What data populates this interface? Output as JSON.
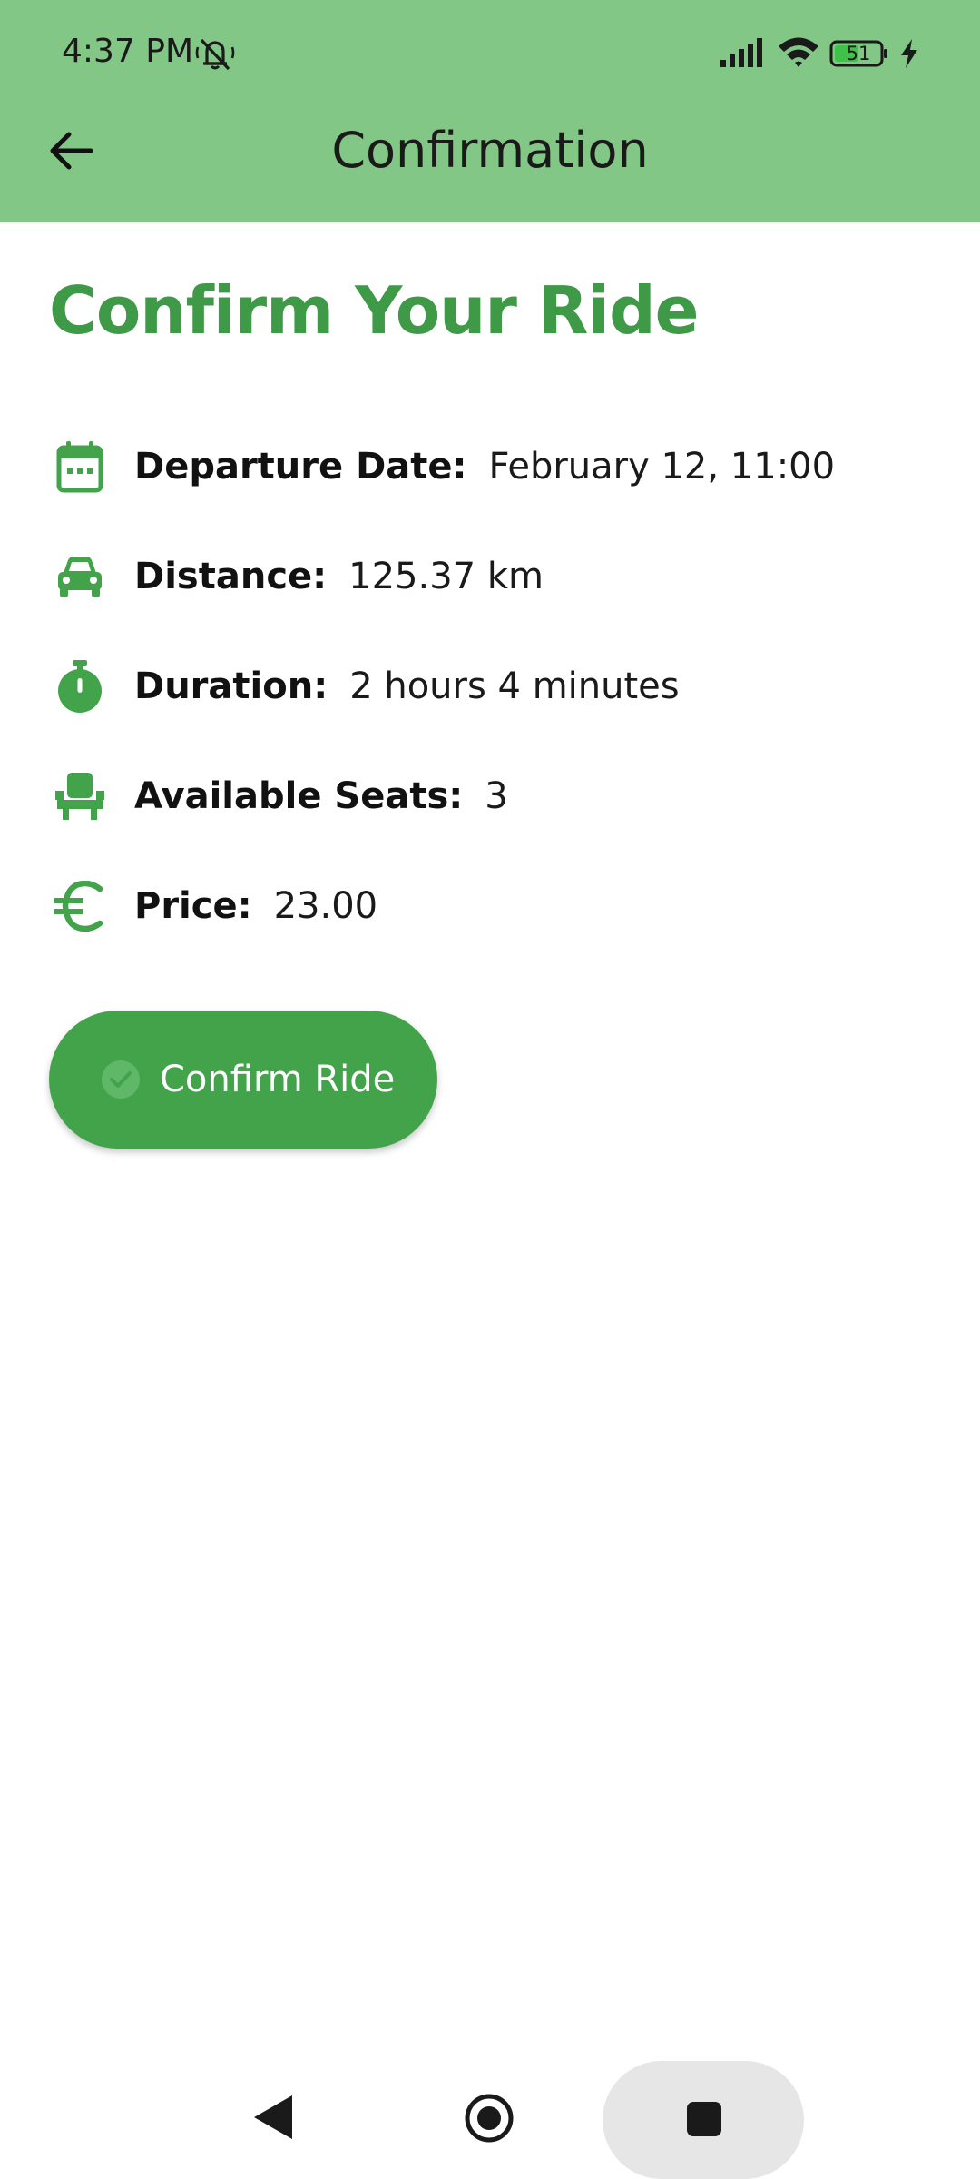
{
  "status_bar": {
    "time": "4:37 PM",
    "battery": "51",
    "icons": [
      "bell-off-icon",
      "signal-icon",
      "wifi-icon",
      "battery-icon",
      "charging-icon"
    ]
  },
  "app_bar": {
    "title": "Confirmation",
    "back_icon": "arrow-left-icon"
  },
  "page": {
    "title": "Confirm Your Ride"
  },
  "details": [
    {
      "icon": "calendar-icon",
      "label": "Departure Date:",
      "value": "February 12, 11:00"
    },
    {
      "icon": "car-icon",
      "label": "Distance:",
      "value": "125.37 km"
    },
    {
      "icon": "stopwatch-icon",
      "label": "Duration:",
      "value": "2 hours 4 minutes"
    },
    {
      "icon": "seat-icon",
      "label": "Available Seats:",
      "value": "3"
    },
    {
      "icon": "euro-icon",
      "label": "Price:",
      "value": "23.00"
    }
  ],
  "confirm_button": {
    "label": "Confirm Ride",
    "icon": "check-circle-icon"
  },
  "nav_bar": {
    "icons": [
      "nav-back-icon",
      "nav-home-icon",
      "nav-recents-icon"
    ]
  },
  "colors": {
    "app_bar": "#82c785",
    "accent": "#3f9a47",
    "button": "#43a34a"
  }
}
